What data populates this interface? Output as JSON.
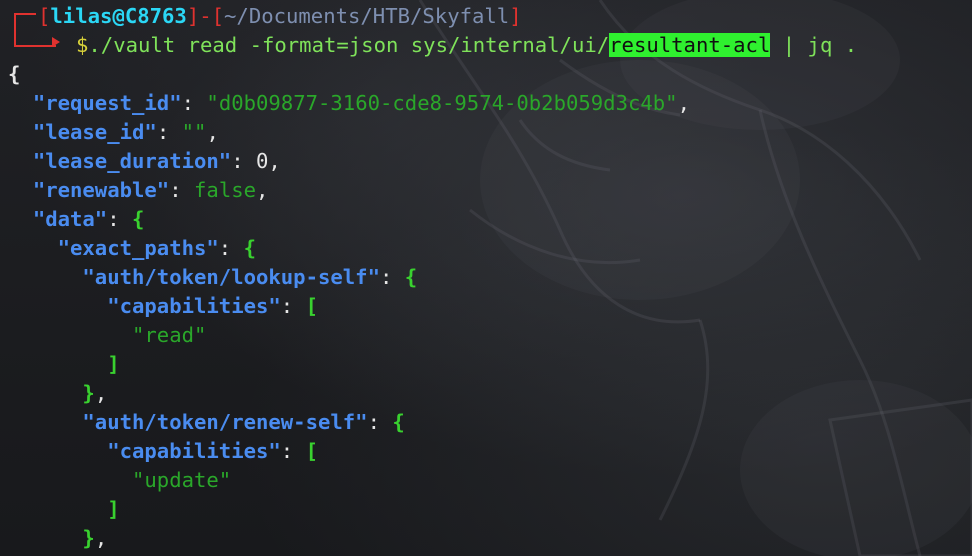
{
  "prompt": {
    "user": "lilas",
    "at": "@",
    "host": "C8763",
    "path": "~/Documents/HTB/Skyfall",
    "symbol": "$",
    "command_pre": "./vault read -format=json sys/internal/ui/",
    "command_highlight": "resultant-acl",
    "command_post": " | jq ."
  },
  "output": {
    "request_id_key": "\"request_id\"",
    "request_id_val": "\"d0b09877-3160-cde8-9574-0b2b059d3c4b\"",
    "lease_id_key": "\"lease_id\"",
    "lease_id_val": "\"\"",
    "lease_duration_key": "\"lease_duration\"",
    "lease_duration_val": "0",
    "renewable_key": "\"renewable\"",
    "renewable_val": "false",
    "data_key": "\"data\"",
    "exact_paths_key": "\"exact_paths\"",
    "path1_key": "\"auth/token/lookup-self\"",
    "cap_key": "\"capabilities\"",
    "path1_cap": "\"read\"",
    "path2_key": "\"auth/token/renew-self\"",
    "path2_cap": "\"update\""
  },
  "colors": {
    "prompt_red": "#e0322f",
    "host_cyan": "#2bd7f5",
    "json_key_blue": "#4a8cf0",
    "json_string_green": "#2aa72a",
    "highlight_green": "#2ff02f"
  }
}
